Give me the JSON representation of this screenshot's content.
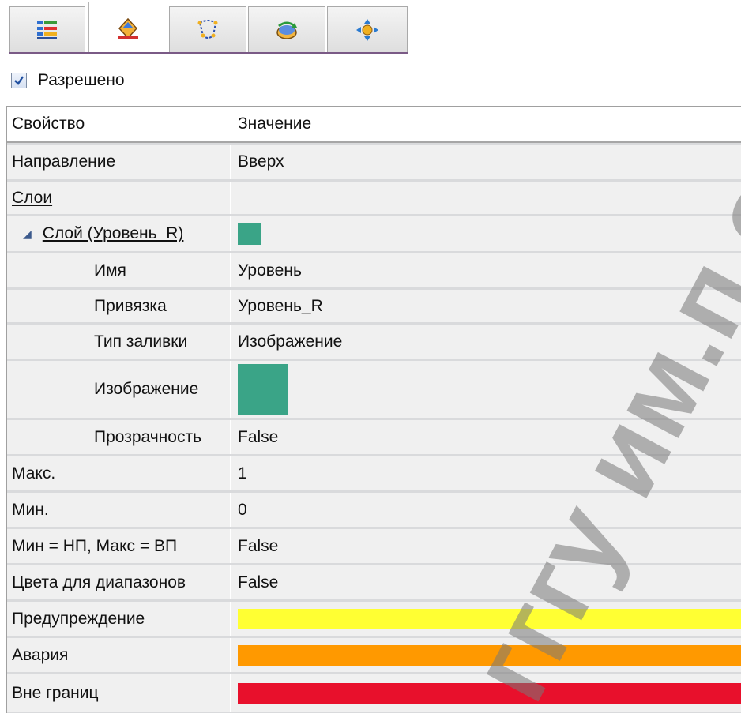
{
  "tabs": [
    {
      "icon": "list-icon"
    },
    {
      "icon": "fill-style-icon",
      "active": true
    },
    {
      "icon": "shape-outline-icon"
    },
    {
      "icon": "rotate-icon"
    },
    {
      "icon": "move-icon"
    }
  ],
  "enabled": {
    "label": "Разрешено",
    "checked": true
  },
  "grid": {
    "header": {
      "property": "Свойство",
      "value": "Значение"
    },
    "rows": {
      "direction": {
        "name": "Направление",
        "value": "Вверх"
      },
      "layers": {
        "name": "Слои",
        "value": ""
      },
      "layer": {
        "name": "Слой (Уровень_R)",
        "color": "#3aa487"
      },
      "layer_name": {
        "name": "Имя",
        "value": "Уровень"
      },
      "binding": {
        "name": "Привязка",
        "value": "Уровень_R"
      },
      "fill_type": {
        "name": "Тип заливки",
        "value": "Изображение"
      },
      "image": {
        "name": "Изображение",
        "color": "#3aa487"
      },
      "transparency": {
        "name": "Прозрачность",
        "value": "False"
      },
      "max": {
        "name": "Макс.",
        "value": "1"
      },
      "min": {
        "name": "Мин.",
        "value": "0"
      },
      "min_max_lim": {
        "name": "Мин = НП, Макс = ВП",
        "value": "False"
      },
      "range_colors": {
        "name": "Цвета для диапазонов",
        "value": "False"
      },
      "warning": {
        "name": "Предупреждение",
        "color": "#ffff33"
      },
      "alarm": {
        "name": "Авария",
        "color": "#ff9900"
      },
      "out_of_range": {
        "name": "Вне границ",
        "color": "#e8102c"
      }
    }
  },
  "watermark": "гггу им.п.о.с"
}
